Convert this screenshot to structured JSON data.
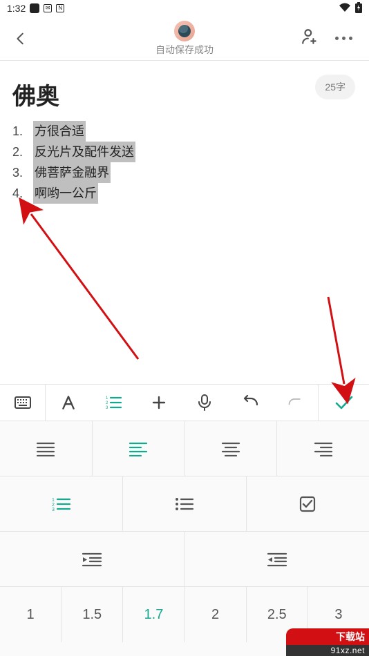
{
  "statusbar": {
    "time": "1:32"
  },
  "topbar": {
    "subtitle": "自动保存成功"
  },
  "badge": {
    "word_count": "25字"
  },
  "note": {
    "title": "佛奥",
    "items": [
      "方很合适",
      "反光片及配件发送",
      "佛菩萨金融界",
      "啊哟一公斤"
    ]
  },
  "panel": {
    "line_spacing": [
      "1",
      "1.5",
      "1.7",
      "2",
      "2.5",
      "3"
    ]
  },
  "watermark": {
    "top": "下载站",
    "bottom": "91xz.net"
  }
}
